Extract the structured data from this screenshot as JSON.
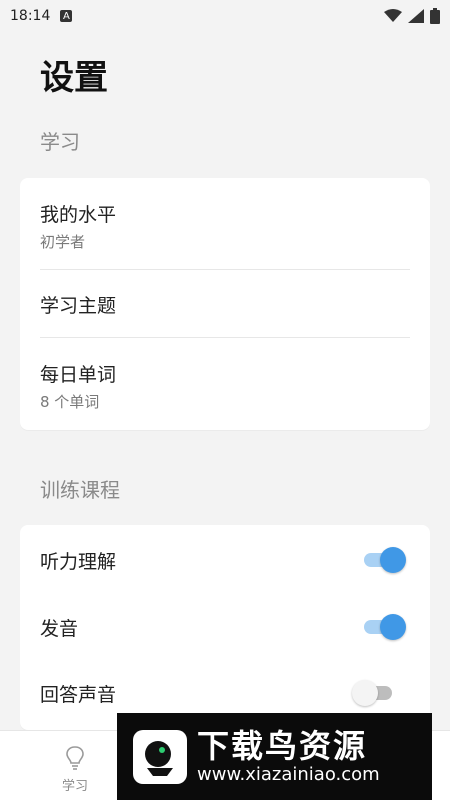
{
  "status": {
    "time": "18:14",
    "notif_letter": "A"
  },
  "page": {
    "title": "设置"
  },
  "sections": {
    "study": {
      "title": "学习",
      "items": [
        {
          "title": "我的水平",
          "subtitle": "初学者"
        },
        {
          "title": "学习主题"
        },
        {
          "title": "每日单词",
          "subtitle": "8 个单词"
        }
      ]
    },
    "training": {
      "title": "训练课程",
      "items": [
        {
          "title": "听力理解",
          "enabled": true
        },
        {
          "title": "发音",
          "enabled": true
        },
        {
          "title": "回答声音",
          "enabled": false
        }
      ]
    }
  },
  "bottom_nav": [
    {
      "label": "学习",
      "icon": "lightbulb-icon"
    }
  ],
  "watermark": {
    "title": "下载鸟资源",
    "url": "www.xiazainiao.com"
  },
  "colors": {
    "accent": "#4098e6",
    "accent_track": "#a9d1f4",
    "background": "#f3f3f3"
  }
}
